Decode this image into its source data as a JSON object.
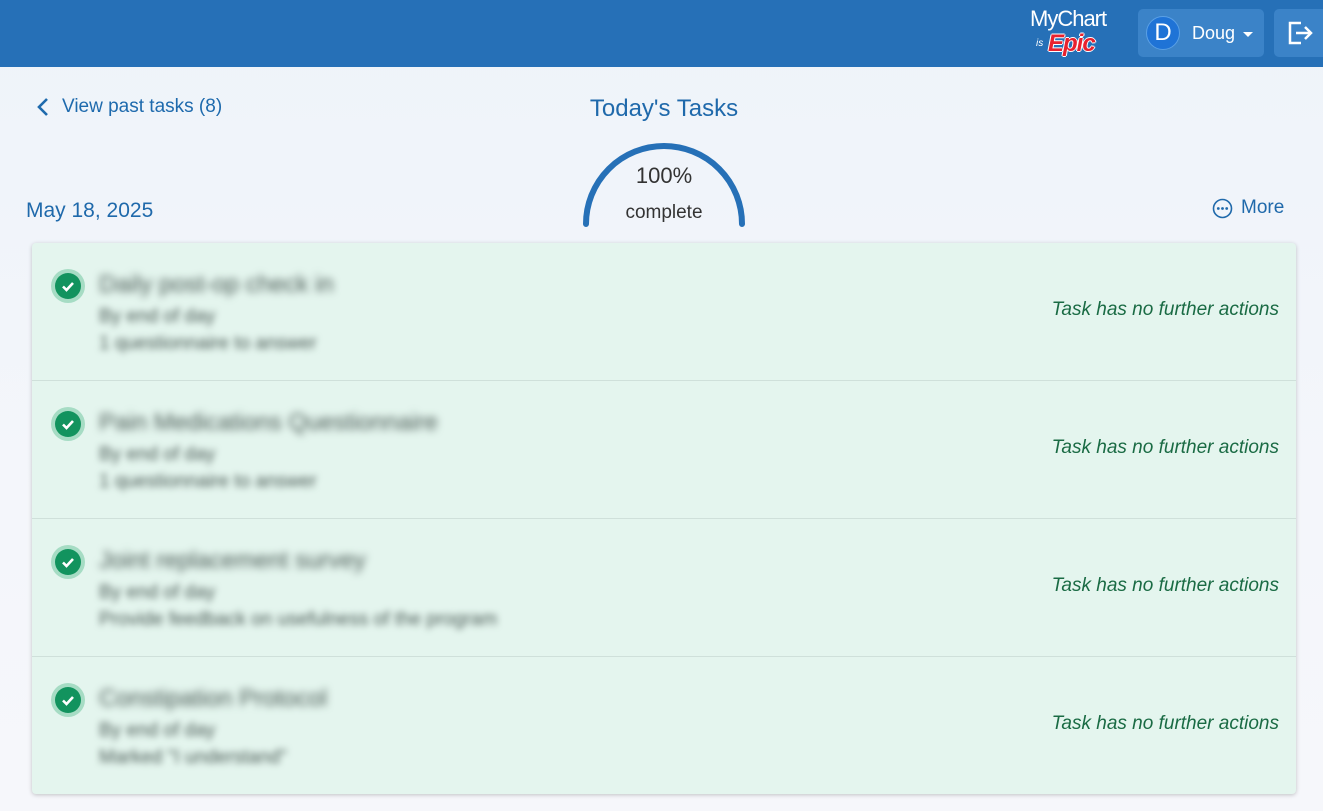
{
  "header": {
    "brand_top": "MyChart",
    "brand_is": "is",
    "brand_bottom": "Epic",
    "user_initial": "D",
    "user_name": "Doug",
    "colors": {
      "bar": "#2670b7",
      "button": "#3b83c8",
      "avatar": "#1f73d6"
    }
  },
  "subheader": {
    "back_link": "View past tasks (8)",
    "title": "Today's Tasks",
    "progress_value": "100%",
    "progress_label": "complete",
    "progress_fraction": 1.0,
    "date": "May 18, 2025",
    "more_label": "More"
  },
  "tasks": [
    {
      "title": "Daily post-op check in",
      "line1": "By end of day",
      "line2": "1 questionnaire to answer",
      "status": "Task has no further actions"
    },
    {
      "title": "Pain Medications Questionnaire",
      "line1": "By end of day",
      "line2": "1 questionnaire to answer",
      "status": "Task has no further actions"
    },
    {
      "title": "Joint replacement survey",
      "line1": "By end of day",
      "line2": "Provide feedback on usefulness of the program",
      "status": "Task has no further actions"
    },
    {
      "title": "Constipation Protocol",
      "line1": "By end of day",
      "line2": "Marked \"I understand\"",
      "status": "Task has no further actions"
    }
  ],
  "colors": {
    "accent": "#1f69ab",
    "task_bg": "#e4f5ee",
    "check_green": "#12935e",
    "status_green": "#1a6b44"
  }
}
